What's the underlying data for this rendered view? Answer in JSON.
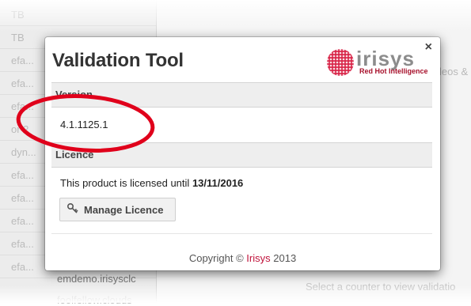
{
  "background": {
    "list_rows": [
      "TB",
      "TB",
      "efa...",
      "efa...",
      "efa...",
      "or 2",
      "dyn...",
      "efa...",
      "efa...",
      "efa...",
      "efa...",
      "efa..."
    ],
    "partial_text": "leos &",
    "host_text": "emdemo.irisysclc",
    "host_text_2": "foolfellow.clouds",
    "hint_text": "Select a counter to view validatio"
  },
  "modal": {
    "title": "Validation Tool",
    "close_label": "×",
    "logo": {
      "name": "irisys",
      "tagline": "Red Hot Intelligence"
    },
    "version": {
      "heading": "Version",
      "value": "4.1.1125.1"
    },
    "licence": {
      "heading": "Licence",
      "text_prefix": "This product is licensed until",
      "expiry_date": "13/11/2016",
      "button_icon": "key-icon",
      "button_label": "Manage Licence"
    },
    "footer": {
      "prefix": "Copyright ©",
      "brand": "Irisys",
      "year": "2013"
    }
  },
  "colors": {
    "brand_red": "#c0143c",
    "annotation_red": "#e0001b",
    "logo_grey": "#8c8c8c"
  }
}
